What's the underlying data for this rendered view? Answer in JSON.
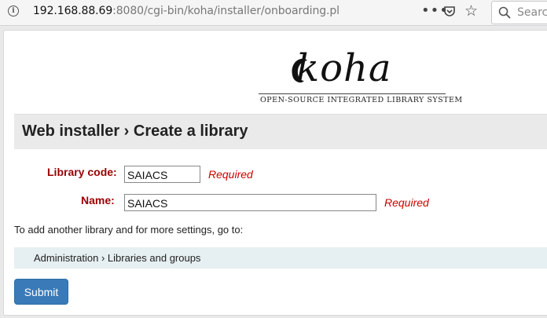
{
  "browser": {
    "url_host": "192.168.88.69",
    "url_rest": ":8080/cgi-bin/koha/installer/onboarding.pl",
    "search_placeholder": "Search"
  },
  "logo": {
    "wordmark": "koha",
    "tagline": "OPEN-SOURCE INTEGRATED LIBRARY SYSTEM"
  },
  "page_title": "Web installer › Create a library",
  "form": {
    "library_code_label": "Library code:",
    "library_code_value": "SAIACS",
    "name_label": "Name:",
    "name_value": "SAIACS",
    "required_text": "Required"
  },
  "note": "To add another library and for more settings, go to:",
  "admin_link": "Administration › Libraries and groups",
  "submit_label": "Submit"
}
